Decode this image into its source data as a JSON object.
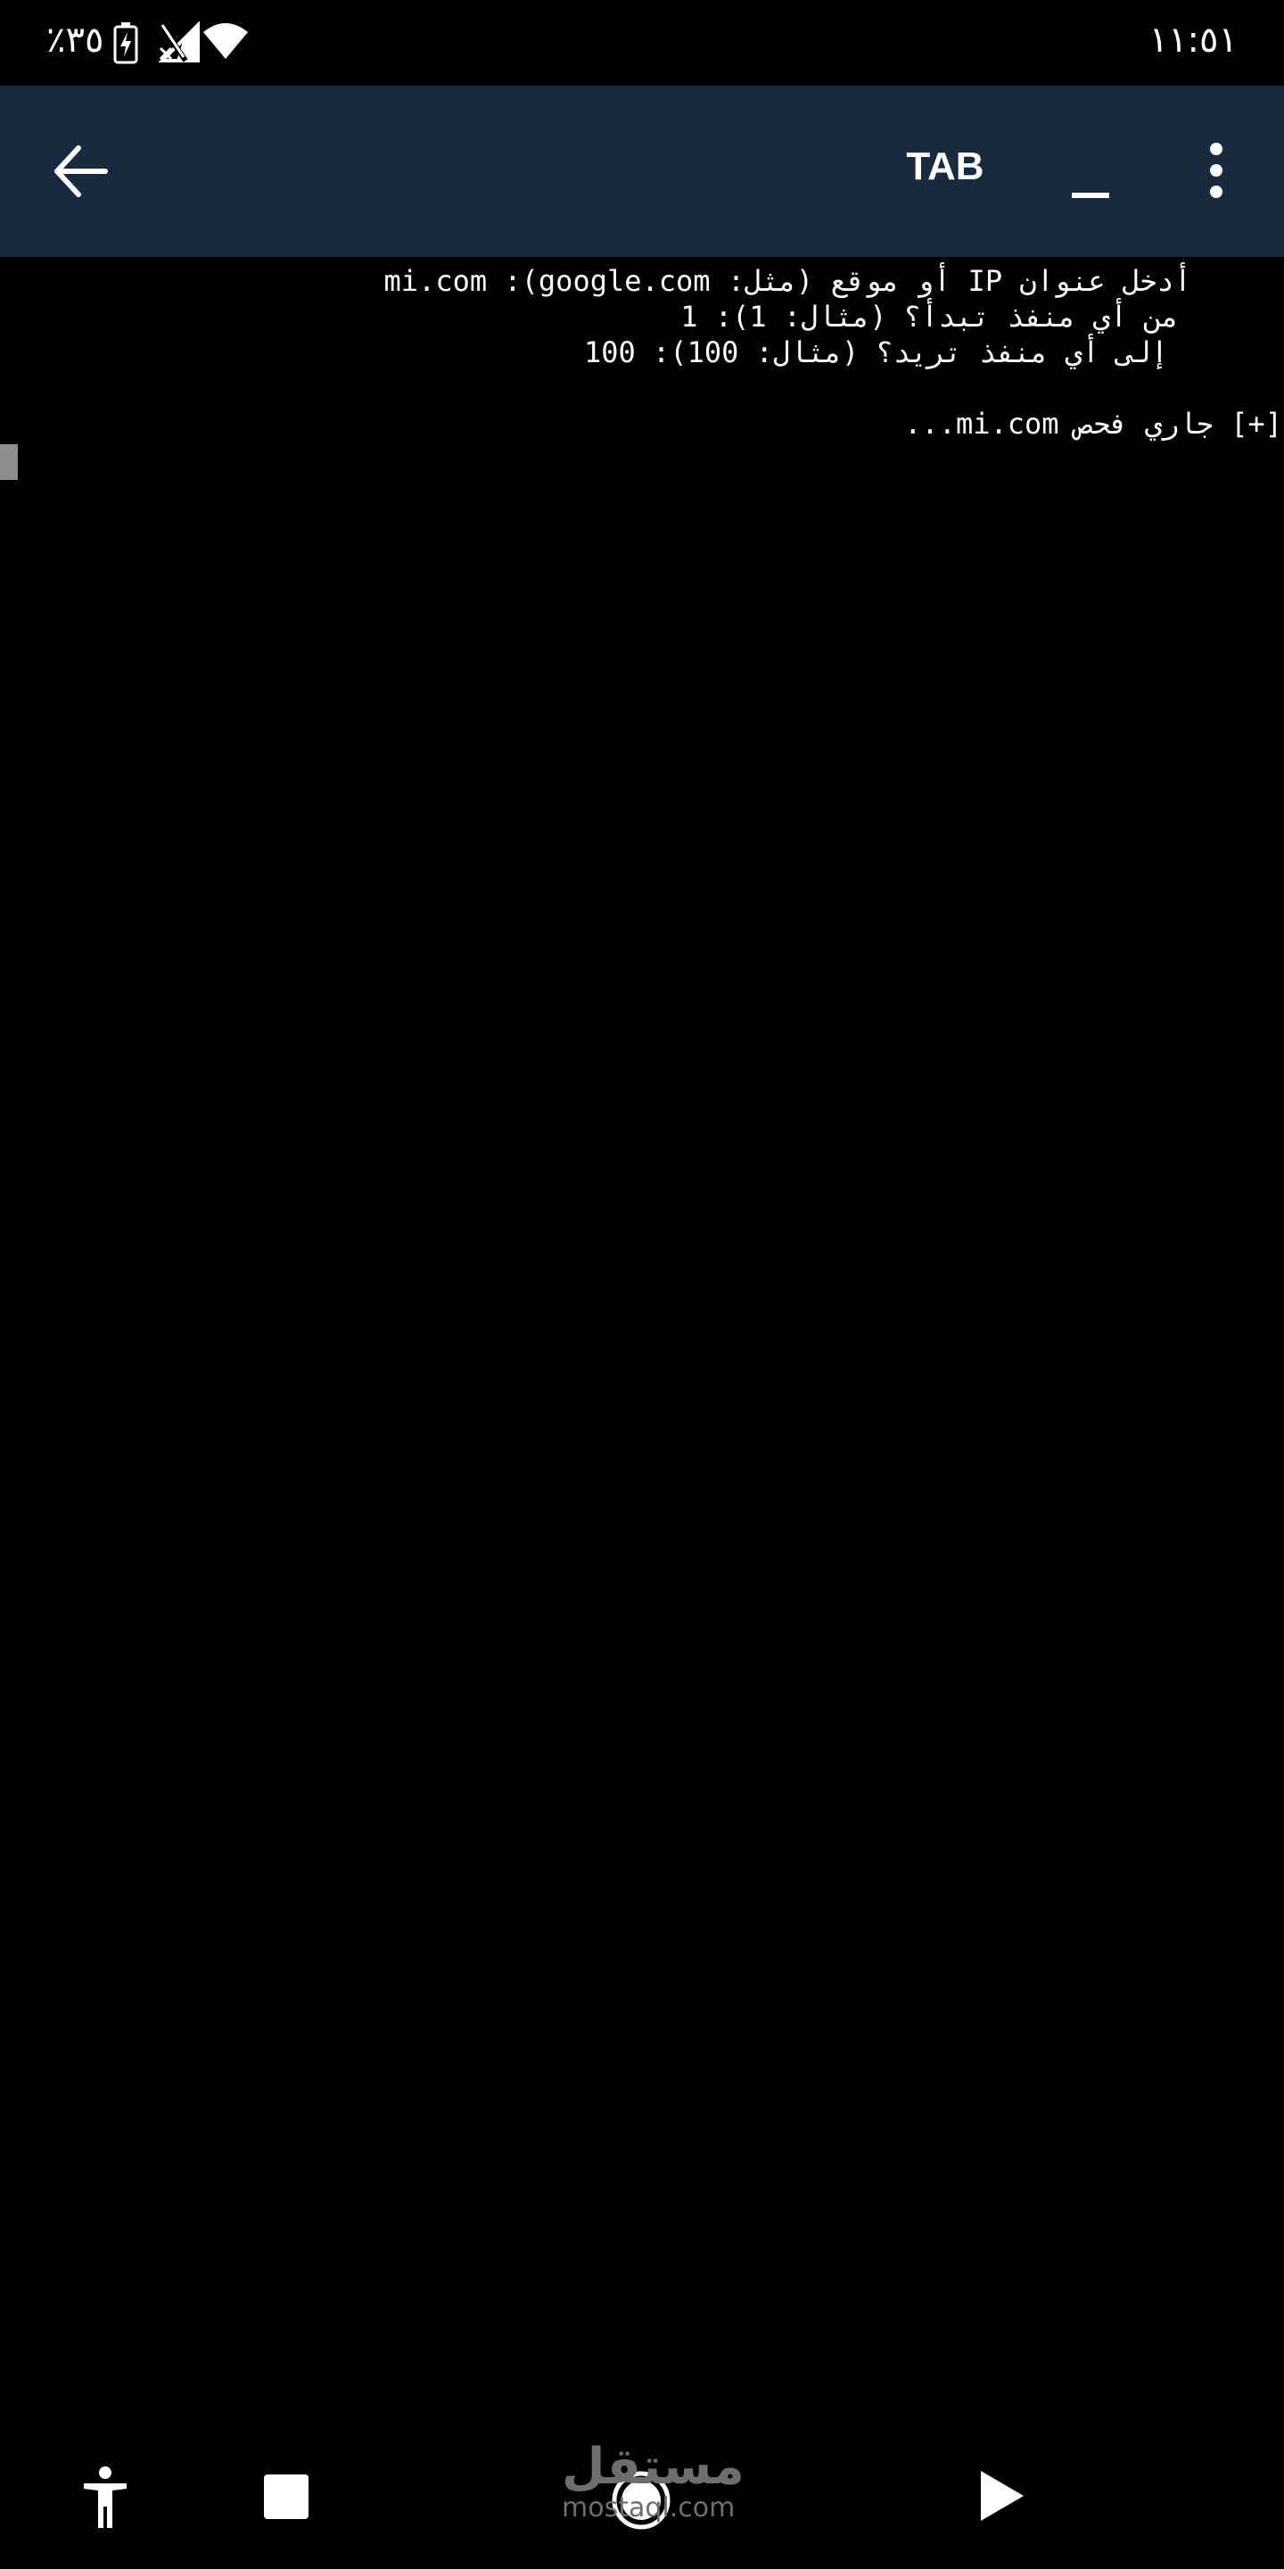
{
  "status_bar": {
    "time": "١١:٥١",
    "battery_percent": "٪٣٥",
    "icons": [
      "battery-charging-icon",
      "no-signal-icon",
      "wifi-icon"
    ]
  },
  "toolbar": {
    "back_icon": "arrow-left-icon",
    "title": "TAB",
    "minimize_label": "_",
    "more_icon": "more-vert-icon",
    "background_color": "#182a3f"
  },
  "terminal": {
    "lines": [
      "أدخل عنوان IP أو موقع (مثل: google.com): mi.com",
      "من أي منفذ تبدأ؟ (مثال: 1): 1",
      "إلى أي منفذ تريد؟ (مثال: 100): 100",
      "[+] جاري فحص mi.com..."
    ],
    "background_color": "#000000",
    "text_color": "#ffffff"
  },
  "bottom_nav": {
    "items": [
      "accessibility-icon",
      "stop-icon",
      "home-circle-icon",
      "play-icon"
    ]
  },
  "watermark": {
    "arabic": "مستقل",
    "latin": "mostaql.com"
  }
}
